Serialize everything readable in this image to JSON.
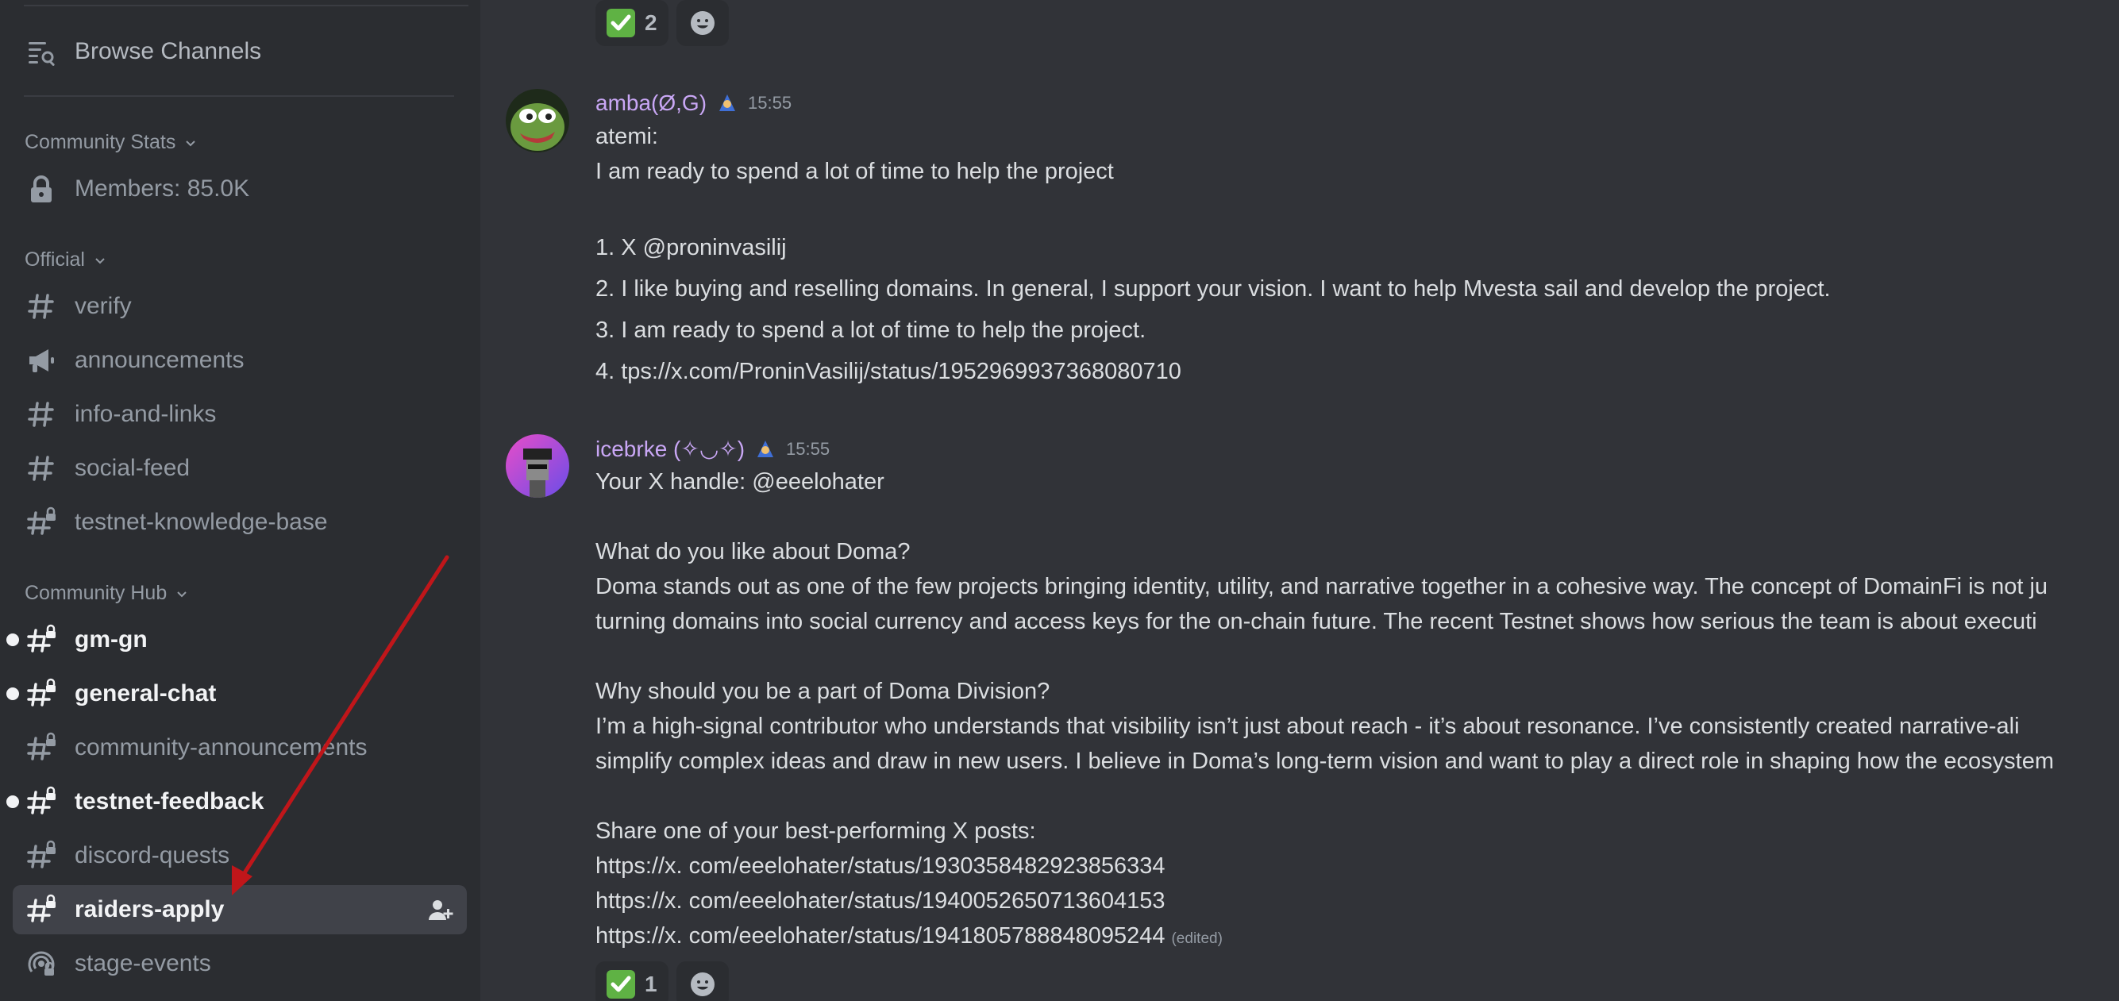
{
  "sidebar": {
    "browse_channels": "Browse Channels",
    "categories": {
      "community_stats": "Community Stats",
      "official": "Official",
      "community_hub": "Community Hub"
    },
    "members_label": "Members: 85.0K",
    "channels": {
      "verify": "verify",
      "announcements": "announcements",
      "info_and_links": "info-and-links",
      "social_feed": "social-feed",
      "testnet_knowledge_base": "testnet-knowledge-base",
      "gm_gn": "gm-gn",
      "general_chat": "general-chat",
      "community_announcements": "community-announcements",
      "testnet_feedback": "testnet-feedback",
      "discord_quests": "discord-quests",
      "raiders_apply": "raiders-apply",
      "stage_events": "stage-events"
    }
  },
  "chat": {
    "top_reaction": {
      "emoji": "white-check-mark",
      "count": "2"
    },
    "messages": [
      {
        "author": "amba(Ø,G)",
        "author_color": "#c9a7f5",
        "timestamp": "15:55",
        "lines": [
          "atemi:",
          "I am ready to spend a lot of time to help the project",
          "1. X @proninvasilij",
          "2. I like buying and reselling domains. In general, I support your vision. I want to help Mvesta sail and develop the project.",
          "3. I am ready to spend a lot of time to help the project.",
          "4. tps://x.com/ProninVasilij/status/1952969937368080710"
        ]
      },
      {
        "author": "icebrke (✧◡✧)",
        "author_color": "#c9a7f5",
        "timestamp": "15:55",
        "lines": [
          "Your X handle: @eeelohater",
          "What do you like about Doma?",
          "Doma stands out as one of the few projects bringing identity, utility, and narrative together in a cohesive way. The concept of DomainFi is not ju",
          "turning domains into social currency and access keys for the on-chain future. The recent Testnet shows how serious the team is about executi",
          "Why should you be a part of Doma Division?",
          "I’m a high-signal contributor who understands that visibility isn’t just about reach - it’s about resonance. I’ve consistently created narrative-ali",
          "simplify complex ideas and draw in new users. I believe in Doma’s long-term vision and want to play a direct role in shaping how the ecosystem",
          "Share one of your best-performing X posts:",
          "https://x. com/eeelohater/status/1930358482923856334",
          "https://x. com/eeelohater/status/1940052650713604153",
          "https://x. com/eeelohater/status/1941805788848095244"
        ],
        "edited_label": "(edited)",
        "reaction": {
          "emoji": "white-check-mark",
          "count": "1"
        }
      }
    ]
  },
  "colors": {
    "sidebar_bg": "#2b2d31",
    "chat_bg": "#313338",
    "selected_bg": "#404249",
    "arrow": "#c0161a",
    "check_green": "#5fb244"
  }
}
